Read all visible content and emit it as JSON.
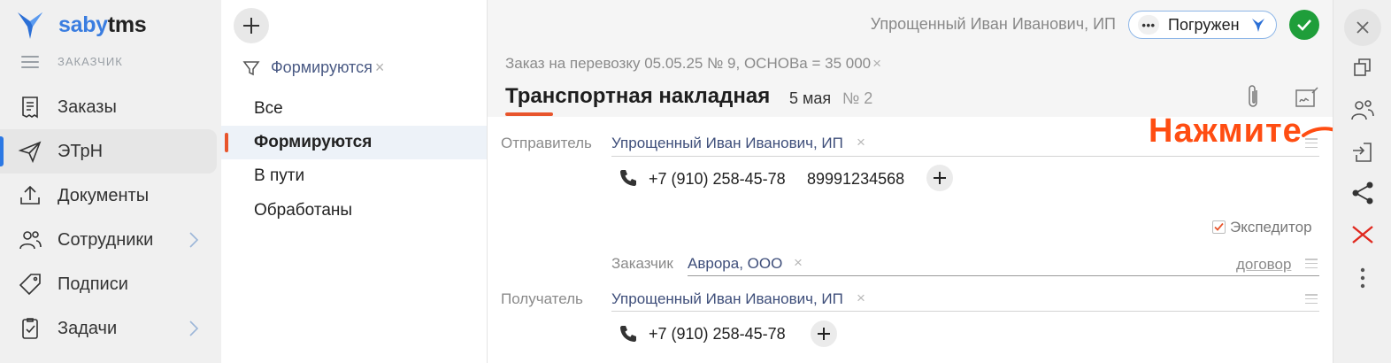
{
  "app": {
    "logo_part1": "saby",
    "logo_part2": "tms",
    "role": "ЗАКАЗЧИК"
  },
  "sidebar": {
    "items": [
      {
        "label": "Заказы",
        "icon": "receipt-icon"
      },
      {
        "label": "ЭТрН",
        "icon": "send-icon",
        "active": true
      },
      {
        "label": "Документы",
        "icon": "upload-icon"
      },
      {
        "label": "Сотрудники",
        "icon": "people-icon",
        "has_chevron": true
      },
      {
        "label": "Подписи",
        "icon": "tag-icon"
      },
      {
        "label": "Задачи",
        "icon": "clipboard-icon",
        "has_chevron": true
      }
    ]
  },
  "filters": {
    "active_filter": "Формируются",
    "items": [
      {
        "label": "Все"
      },
      {
        "label": "Формируются",
        "active": true
      },
      {
        "label": "В пути"
      },
      {
        "label": "Обработаны"
      }
    ]
  },
  "header": {
    "org": "Упрощенный Иван Иванович, ИП",
    "status": "Погружен",
    "status_dots": "•••"
  },
  "document": {
    "breadcrumb": "Заказ на перевозку 05.05.25 № 9, ОСНОВа = 35 000",
    "title": "Транспортная накладная",
    "date": "5 мая",
    "number": "№ 2"
  },
  "sender": {
    "label": "Отправитель",
    "value": "Упрощенный Иван Иванович, ИП",
    "phone1": "+7 (910) 258-45-78",
    "phone2": "89991234568"
  },
  "forwarder": {
    "label": "Экспедитор",
    "checked": true
  },
  "customer": {
    "label": "Заказчик",
    "value": "Аврора, ООО",
    "link": "договор"
  },
  "recipient": {
    "label": "Получатель",
    "value": "Упрощенный Иван Иванович, ИП",
    "phone1": "+7 (910) 258-45-78"
  },
  "hint": {
    "text": "Нажмите"
  },
  "toolbar": {
    "buttons": [
      "close-icon",
      "copy-icon",
      "participants-icon",
      "import-icon",
      "share-icon",
      "delete-icon",
      "more-icon"
    ]
  },
  "colors": {
    "accent": "#2b78e4",
    "marker": "#e8552c",
    "hint": "#ff4d12",
    "ok": "#1f9e3a",
    "delete": "#e0281e"
  }
}
